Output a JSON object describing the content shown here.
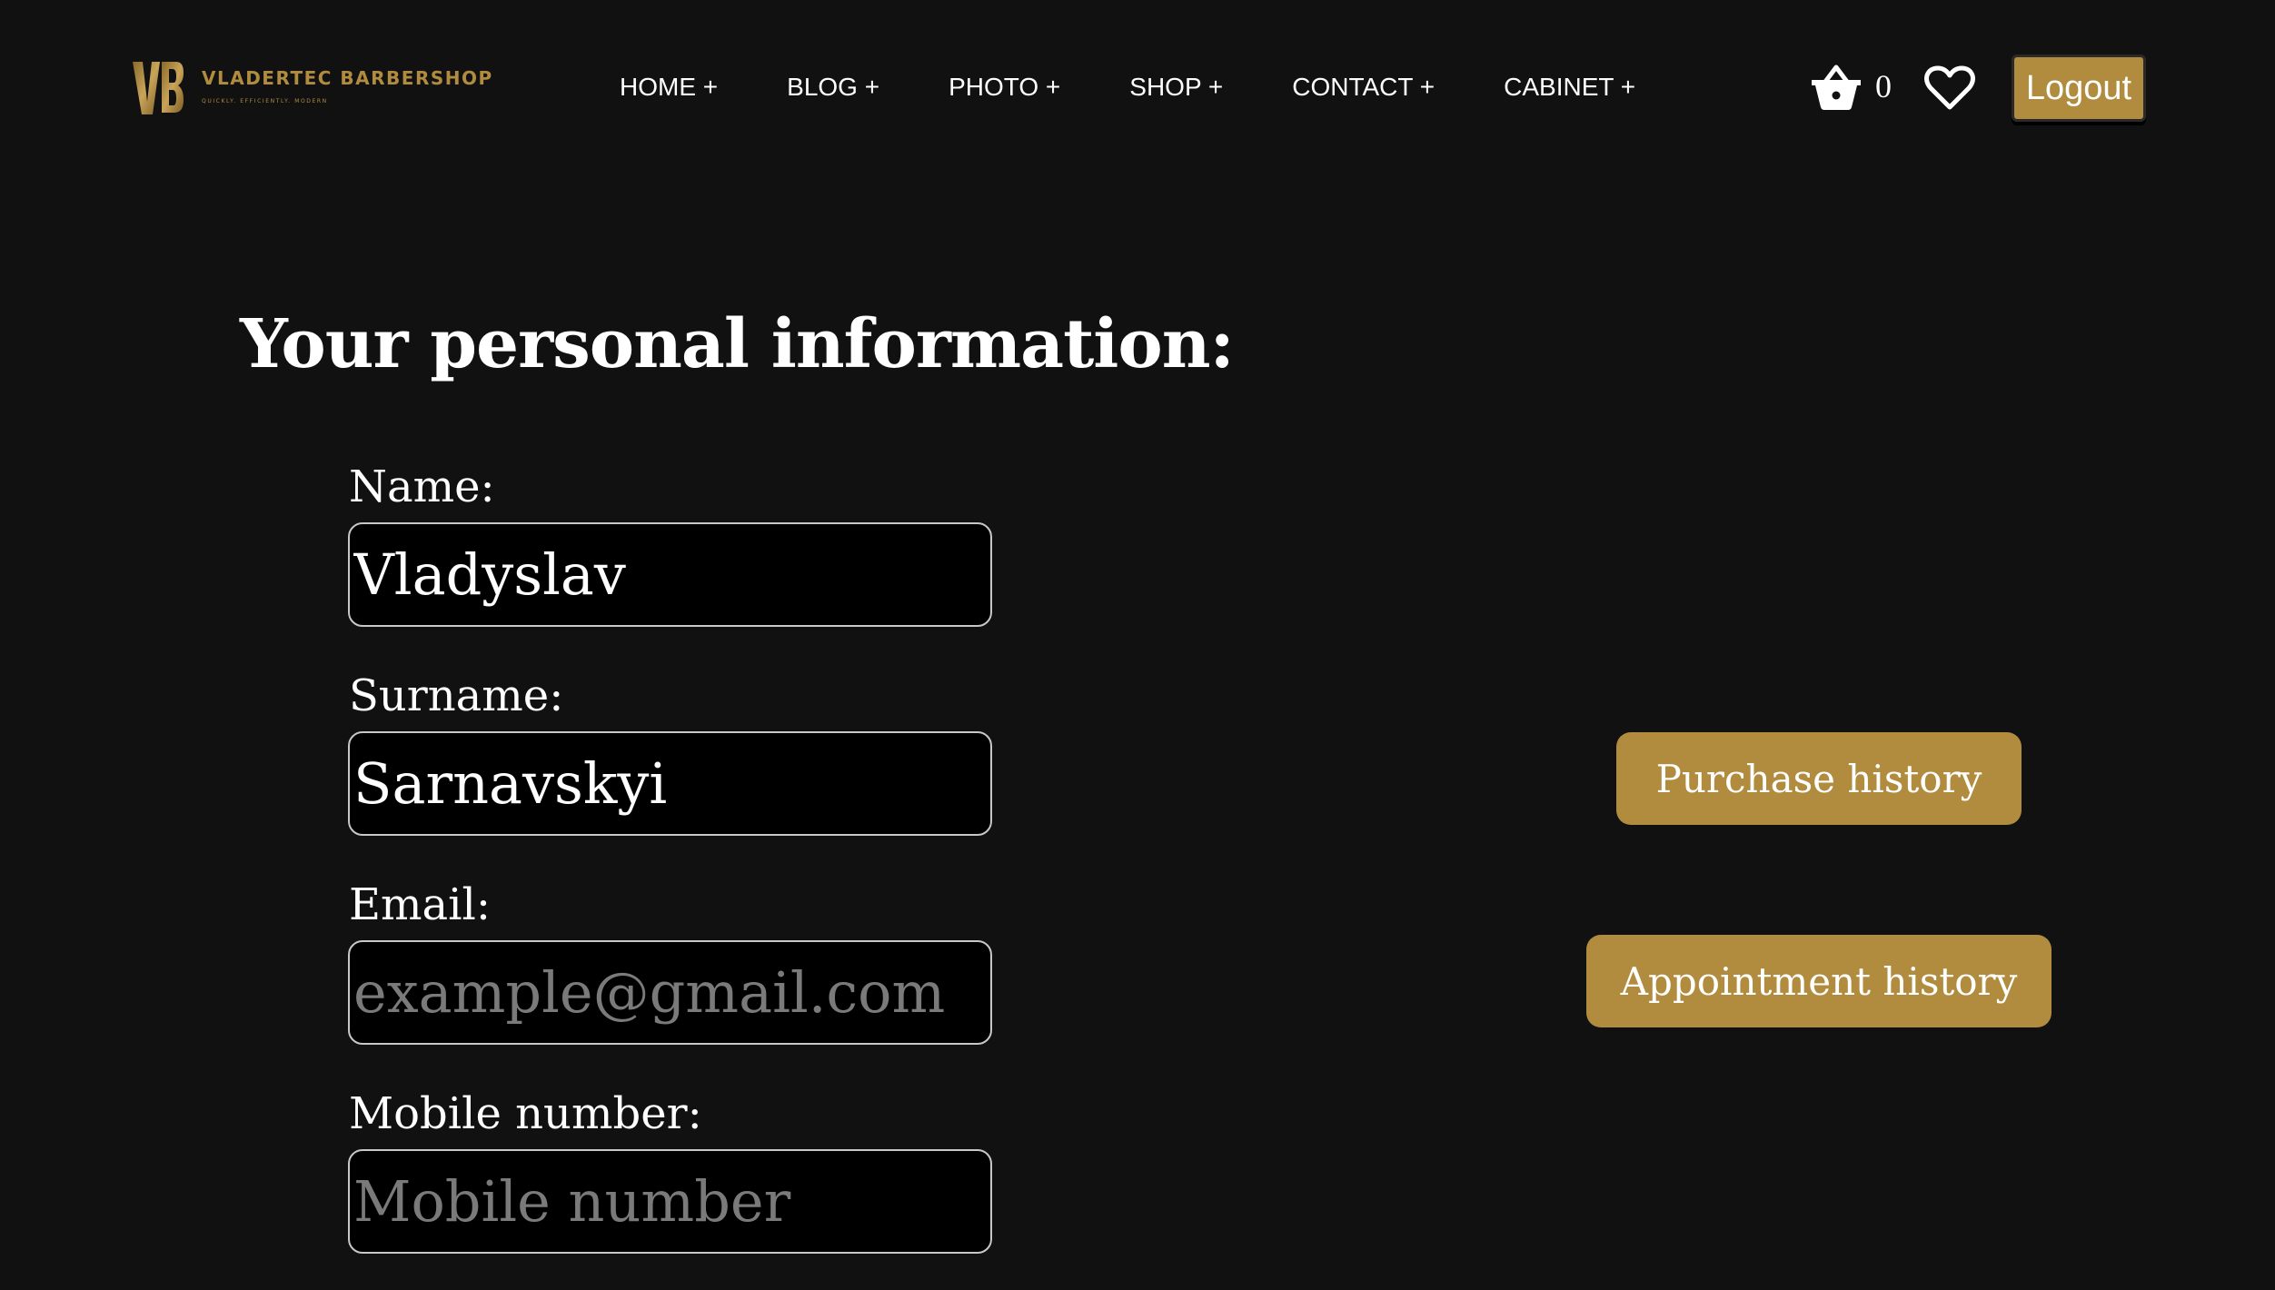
{
  "brand": {
    "monogram": "VB",
    "name": "VLADERTEC BARBERSHOP",
    "tagline": "QUICKLY. EFFICIENTLY. MODERN",
    "accent_color": "#b18c3e"
  },
  "nav": {
    "items": [
      {
        "label": "HOME +"
      },
      {
        "label": "BLOG +"
      },
      {
        "label": "PHOTO +"
      },
      {
        "label": "SHOP +"
      },
      {
        "label": "CONTACT +"
      },
      {
        "label": "CABINET +"
      }
    ]
  },
  "header_actions": {
    "cart_icon": "basket-icon",
    "cart_count": "0",
    "wishlist_icon": "heart-icon",
    "logout_label": "Logout"
  },
  "page": {
    "title": "Your personal information:"
  },
  "form": {
    "name": {
      "label": "Name:",
      "value": "Vladyslav",
      "placeholder": ""
    },
    "surname": {
      "label": "Surname:",
      "value": "Sarnavskyi",
      "placeholder": ""
    },
    "email": {
      "label": "Email:",
      "value": "",
      "placeholder": "example@gmail.com"
    },
    "mobile": {
      "label": "Mobile number:",
      "value": "",
      "placeholder": "Mobile number"
    }
  },
  "actions": {
    "purchase_history": "Purchase history",
    "appointment_history": "Appointment history"
  },
  "colors": {
    "background": "#111112",
    "accent": "#b18c3e",
    "input_background": "#000000",
    "input_border": "#c8c8c8"
  }
}
